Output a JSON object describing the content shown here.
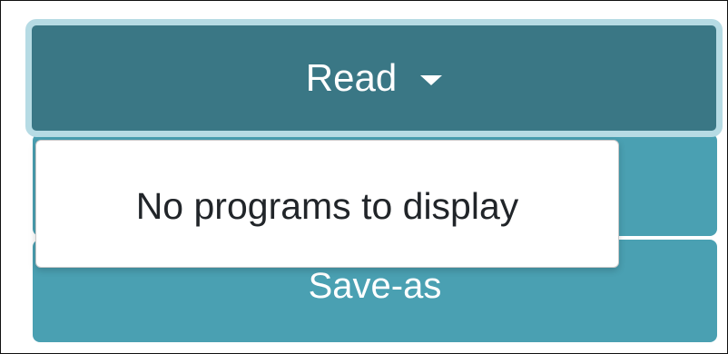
{
  "toolbar": {
    "read_label": "Read",
    "write_label": "",
    "save_as_label": "Save-as"
  },
  "dropdown": {
    "empty_message": "No programs to display"
  },
  "icons": {
    "read_caret": "caret-down-icon"
  },
  "colors": {
    "read_button_bg": "#3a7785",
    "read_button_focus_ring": "#b6dbe4",
    "secondary_button_bg": "#4aa0b2",
    "dropdown_bg": "#ffffff",
    "dropdown_text": "#212529"
  }
}
